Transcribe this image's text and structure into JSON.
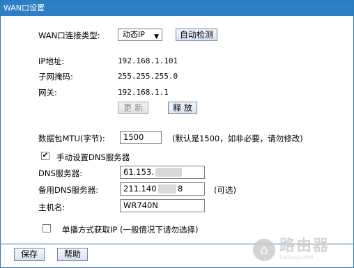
{
  "window": {
    "title": "WAN口设置"
  },
  "connection": {
    "label": "WAN口连接类型:",
    "selected": "动态IP",
    "detect_button": "自动检测"
  },
  "status": {
    "ip_label": "IP地址:",
    "ip_value": "192.168.1.101",
    "mask_label": "子网掩码:",
    "mask_value": "255.255.255.0",
    "gateway_label": "网关:",
    "gateway_value": "192.168.1.1",
    "renew_button": "更 新",
    "release_button": "释 放"
  },
  "mtu": {
    "label": "数据包MTU(字节):",
    "value": "1500",
    "hint": "(默认是1500，如非必要，请勿修改)"
  },
  "dns": {
    "manual_checked": true,
    "manual_label": "手动设置DNS服务器",
    "primary_label": "DNS服务器:",
    "primary_value": "61.153.",
    "secondary_label": "备用DNS服务器:",
    "secondary_value_start": "211.140",
    "secondary_value_end": "8",
    "secondary_hint": "(可选)"
  },
  "host": {
    "label": "主机名:",
    "value": "WR740N"
  },
  "unicast": {
    "checked": false,
    "label": "单播方式获取IP  (一般情况下请勿选择)"
  },
  "footer": {
    "save_button": "保存",
    "help_button": "帮助"
  },
  "watermark": {
    "main": "路由器",
    "sub": "luyouqi.com"
  },
  "colors": {
    "titlebar": "#2d7fc6",
    "border": "#2d79b6"
  }
}
